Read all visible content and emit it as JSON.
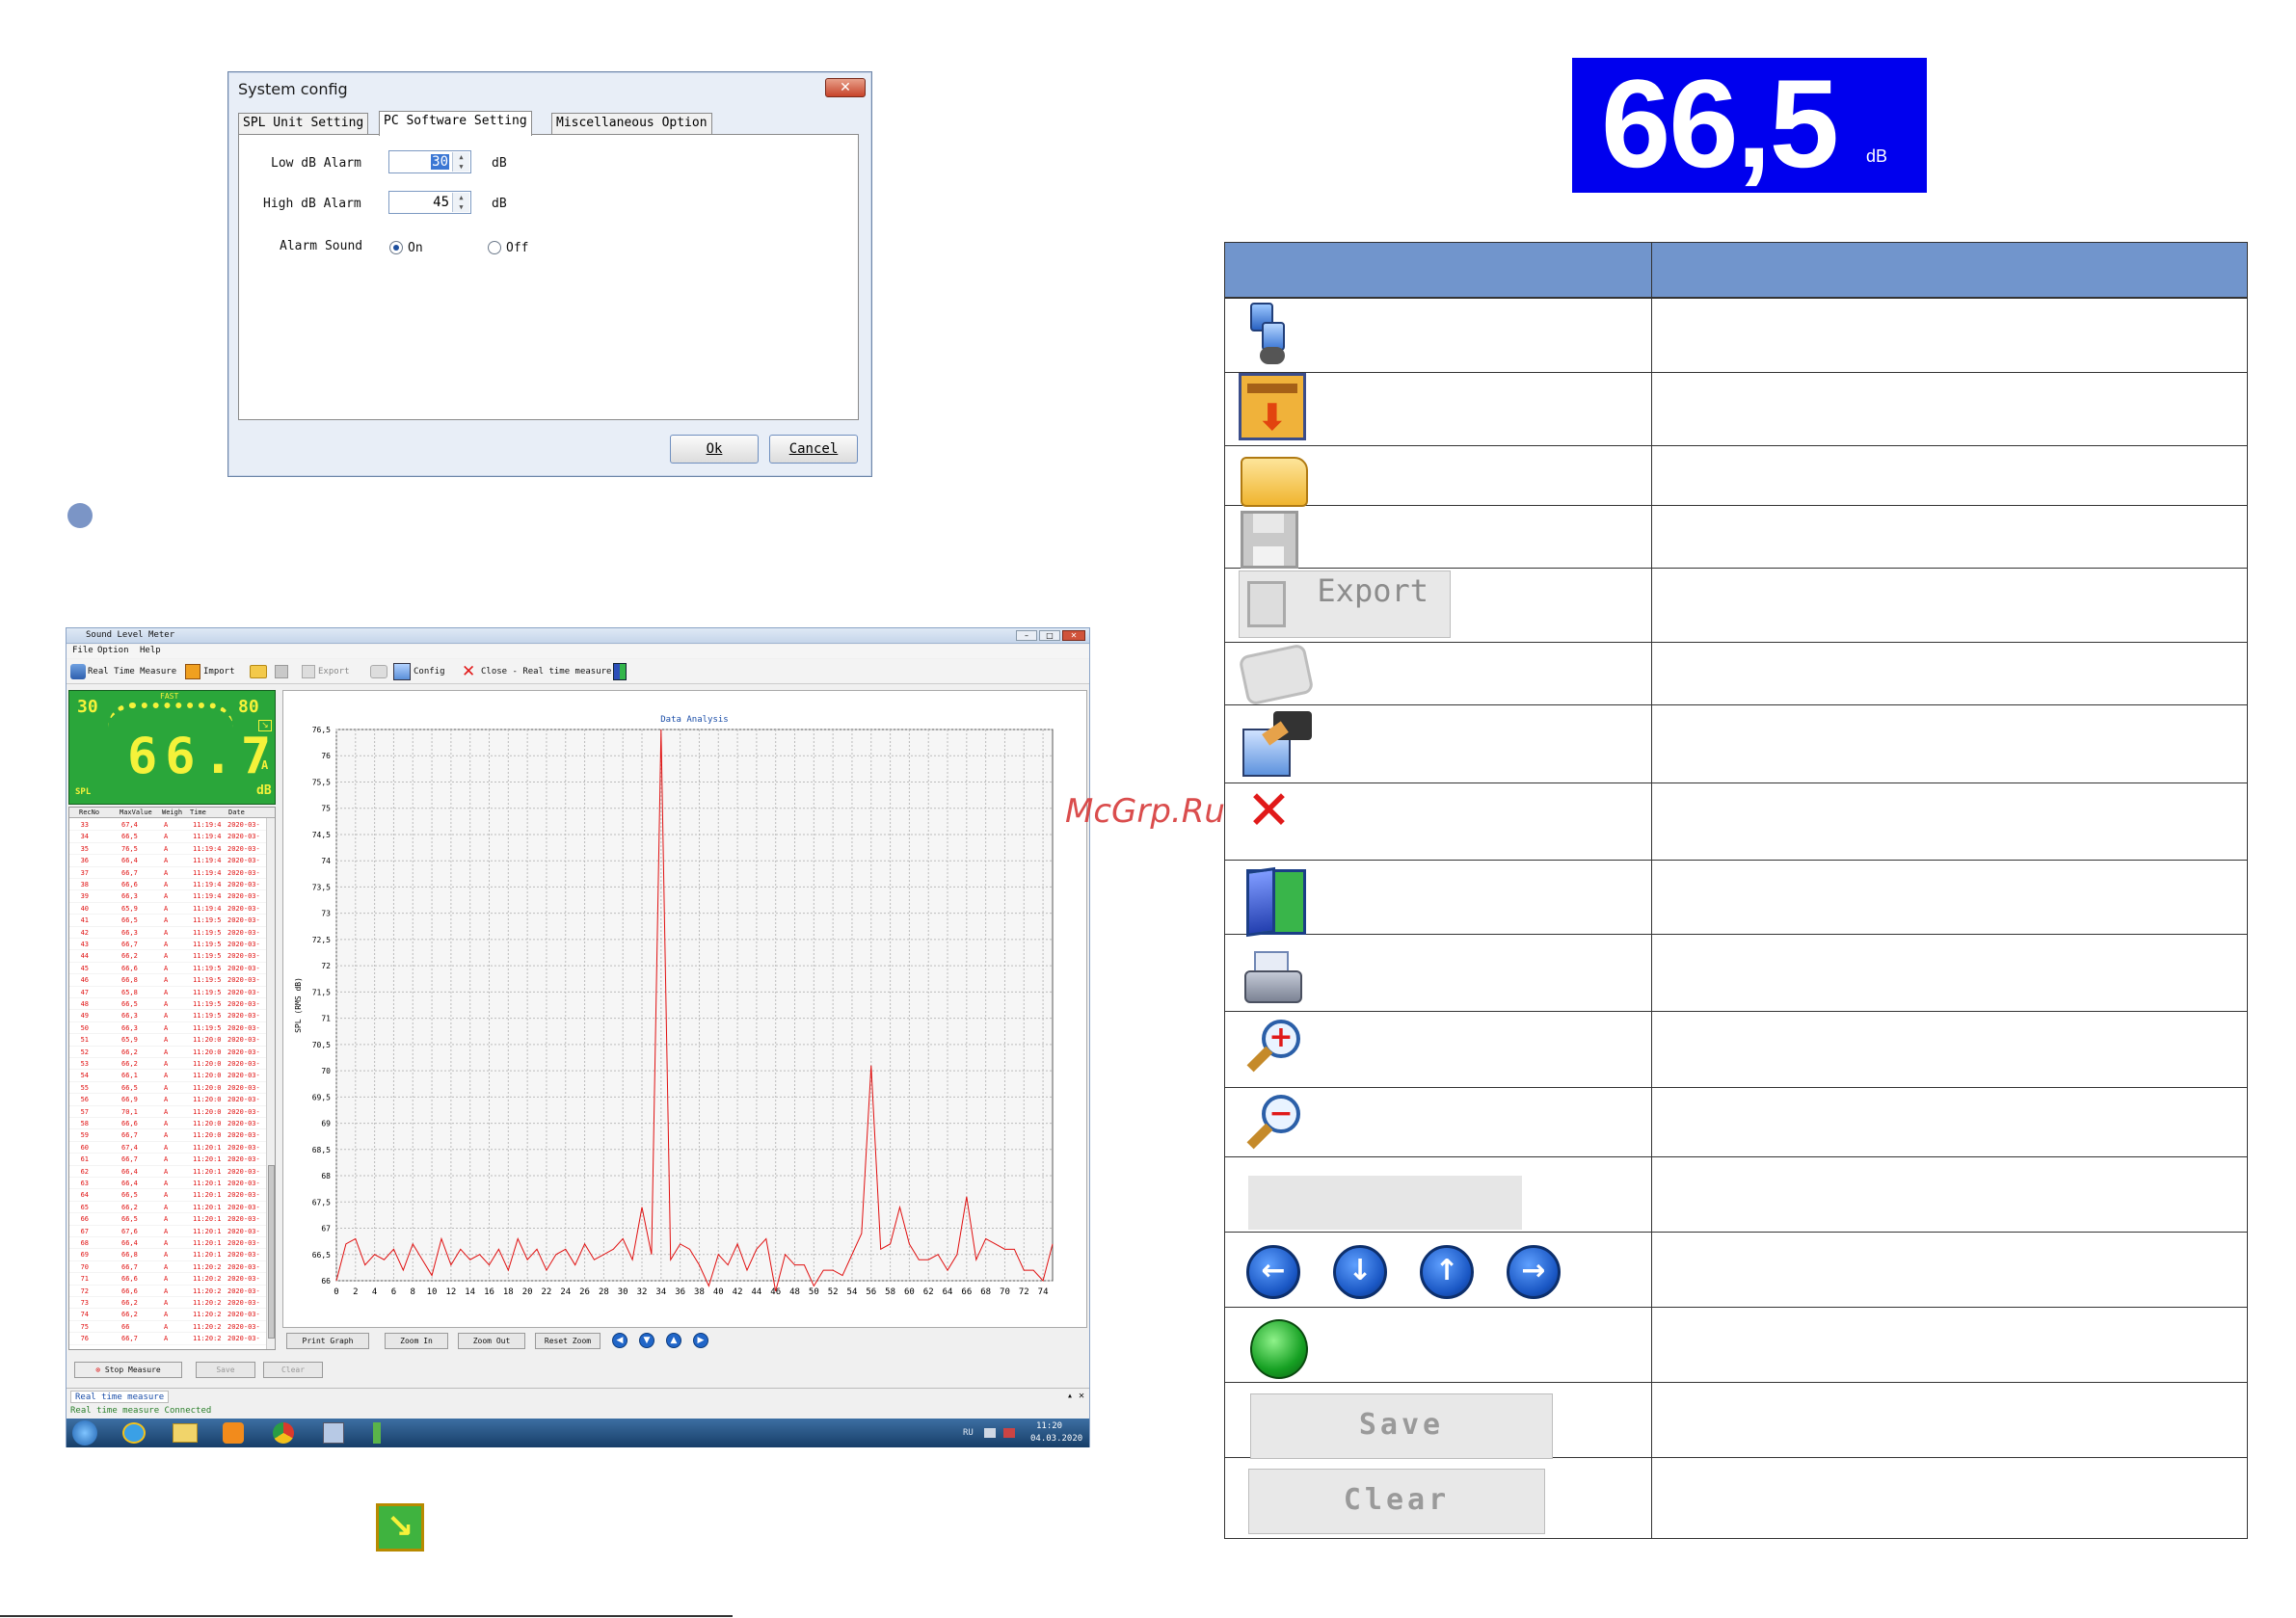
{
  "system_config": {
    "title": "System config",
    "close": "✕",
    "tabs": [
      "SPL Unit Setting",
      "PC Software Setting",
      "Miscellaneous Option"
    ],
    "low_label": "Low dB Alarm",
    "low_value": "30",
    "high_label": "High dB Alarm",
    "high_value": "45",
    "unit": "dB",
    "alarm_label": "Alarm Sound",
    "on_label": "On",
    "off_label": "Off",
    "ok": "Ok",
    "cancel": "Cancel"
  },
  "app": {
    "title": "Sound Level Meter",
    "menu": [
      "File",
      "Option",
      "Help"
    ],
    "toolbar": {
      "realtime": "Real Time Measure",
      "import": "Import",
      "export": "Export",
      "config": "Config",
      "close": "Close - Real time measure"
    },
    "meter": {
      "low": "30",
      "high": "80",
      "mode": "FAST",
      "value": "66.7",
      "weight": "A",
      "unit": "dB",
      "label": "SPL"
    },
    "grid": {
      "headers": [
        "RecNo",
        "MaxValue",
        "Weigh",
        "Time",
        "Date"
      ],
      "rows": [
        [
          "33",
          "67,4",
          "A",
          "11:19:4",
          "2020-03-"
        ],
        [
          "34",
          "66,5",
          "A",
          "11:19:4",
          "2020-03-"
        ],
        [
          "35",
          "76,5",
          "A",
          "11:19:4",
          "2020-03-"
        ],
        [
          "36",
          "66,4",
          "A",
          "11:19:4",
          "2020-03-"
        ],
        [
          "37",
          "66,7",
          "A",
          "11:19:4",
          "2020-03-"
        ],
        [
          "38",
          "66,6",
          "A",
          "11:19:4",
          "2020-03-"
        ],
        [
          "39",
          "66,3",
          "A",
          "11:19:4",
          "2020-03-"
        ],
        [
          "40",
          "65,9",
          "A",
          "11:19:4",
          "2020-03-"
        ],
        [
          "41",
          "66,5",
          "A",
          "11:19:5",
          "2020-03-"
        ],
        [
          "42",
          "66,3",
          "A",
          "11:19:5",
          "2020-03-"
        ],
        [
          "43",
          "66,7",
          "A",
          "11:19:5",
          "2020-03-"
        ],
        [
          "44",
          "66,2",
          "A",
          "11:19:5",
          "2020-03-"
        ],
        [
          "45",
          "66,6",
          "A",
          "11:19:5",
          "2020-03-"
        ],
        [
          "46",
          "66,8",
          "A",
          "11:19:5",
          "2020-03-"
        ],
        [
          "47",
          "65,8",
          "A",
          "11:19:5",
          "2020-03-"
        ],
        [
          "48",
          "66,5",
          "A",
          "11:19:5",
          "2020-03-"
        ],
        [
          "49",
          "66,3",
          "A",
          "11:19:5",
          "2020-03-"
        ],
        [
          "50",
          "66,3",
          "A",
          "11:19:5",
          "2020-03-"
        ],
        [
          "51",
          "65,9",
          "A",
          "11:20:0",
          "2020-03-"
        ],
        [
          "52",
          "66,2",
          "A",
          "11:20:0",
          "2020-03-"
        ],
        [
          "53",
          "66,2",
          "A",
          "11:20:0",
          "2020-03-"
        ],
        [
          "54",
          "66,1",
          "A",
          "11:20:0",
          "2020-03-"
        ],
        [
          "55",
          "66,5",
          "A",
          "11:20:0",
          "2020-03-"
        ],
        [
          "56",
          "66,9",
          "A",
          "11:20:0",
          "2020-03-"
        ],
        [
          "57",
          "70,1",
          "A",
          "11:20:0",
          "2020-03-"
        ],
        [
          "58",
          "66,6",
          "A",
          "11:20:0",
          "2020-03-"
        ],
        [
          "59",
          "66,7",
          "A",
          "11:20:0",
          "2020-03-"
        ],
        [
          "60",
          "67,4",
          "A",
          "11:20:1",
          "2020-03-"
        ],
        [
          "61",
          "66,7",
          "A",
          "11:20:1",
          "2020-03-"
        ],
        [
          "62",
          "66,4",
          "A",
          "11:20:1",
          "2020-03-"
        ],
        [
          "63",
          "66,4",
          "A",
          "11:20:1",
          "2020-03-"
        ],
        [
          "64",
          "66,5",
          "A",
          "11:20:1",
          "2020-03-"
        ],
        [
          "65",
          "66,2",
          "A",
          "11:20:1",
          "2020-03-"
        ],
        [
          "66",
          "66,5",
          "A",
          "11:20:1",
          "2020-03-"
        ],
        [
          "67",
          "67,6",
          "A",
          "11:20:1",
          "2020-03-"
        ],
        [
          "68",
          "66,4",
          "A",
          "11:20:1",
          "2020-03-"
        ],
        [
          "69",
          "66,8",
          "A",
          "11:20:1",
          "2020-03-"
        ],
        [
          "70",
          "66,7",
          "A",
          "11:20:2",
          "2020-03-"
        ],
        [
          "71",
          "66,6",
          "A",
          "11:20:2",
          "2020-03-"
        ],
        [
          "72",
          "66,6",
          "A",
          "11:20:2",
          "2020-03-"
        ],
        [
          "73",
          "66,2",
          "A",
          "11:20:2",
          "2020-03-"
        ],
        [
          "74",
          "66,2",
          "A",
          "11:20:2",
          "2020-03-"
        ],
        [
          "75",
          "66",
          "A",
          "11:20:2",
          "2020-03-"
        ],
        [
          "76",
          "66,7",
          "A",
          "11:20:2",
          "2020-03-"
        ]
      ]
    },
    "graph": {
      "buttons": [
        "Print Graph",
        "Zoom In",
        "Zoom Out",
        "Reset Zoom"
      ]
    },
    "bottom": {
      "stop": "Stop Measure",
      "save": "Save",
      "clear": "Clear",
      "tab": "Real time measure",
      "status": "Real time measure Connected"
    },
    "tray": {
      "lang": "RU",
      "time": "11:20",
      "date": "04.03.2020"
    }
  },
  "chart_data": {
    "type": "line",
    "title": "Data Analysis",
    "ylabel": "SPL (RMS dB)",
    "xlim": [
      0,
      75
    ],
    "ylim": [
      66,
      76.5
    ],
    "xticks": [
      0,
      2,
      4,
      6,
      8,
      10,
      12,
      14,
      16,
      18,
      20,
      22,
      24,
      26,
      28,
      30,
      32,
      34,
      36,
      38,
      40,
      42,
      44,
      46,
      48,
      50,
      52,
      54,
      56,
      58,
      60,
      62,
      64,
      66,
      68,
      70,
      72,
      74
    ],
    "yticks": [
      66,
      66.5,
      67,
      67.5,
      68,
      68.5,
      69,
      69.5,
      70,
      70.5,
      71,
      71.5,
      72,
      72.5,
      73,
      73.5,
      74,
      74.5,
      75,
      75.5,
      76,
      76.5
    ],
    "ytick_labels": [
      "66",
      "66,5",
      "67",
      "67,5",
      "68",
      "68,5",
      "69",
      "69,5",
      "70",
      "70,5",
      "71",
      "71,5",
      "72",
      "72,5",
      "73",
      "73,5",
      "74",
      "74,5",
      "75",
      "75,5",
      "76",
      "76,5"
    ],
    "grid": true,
    "series": [
      {
        "color": "#e01010",
        "x": [
          0,
          1,
          2,
          3,
          4,
          5,
          6,
          7,
          8,
          9,
          10,
          11,
          12,
          13,
          14,
          15,
          16,
          17,
          18,
          19,
          20,
          21,
          22,
          23,
          24,
          25,
          26,
          27,
          28,
          29,
          30,
          31,
          32,
          33,
          34,
          35,
          36,
          37,
          38,
          39,
          40,
          41,
          42,
          43,
          44,
          45,
          46,
          47,
          48,
          49,
          50,
          51,
          52,
          53,
          54,
          55,
          56,
          57,
          58,
          59,
          60,
          61,
          62,
          63,
          64,
          65,
          66,
          67,
          68,
          69,
          70,
          71,
          72,
          73,
          74,
          75
        ],
        "y": [
          66,
          66.7,
          66.8,
          66.3,
          66.5,
          66.4,
          66.6,
          66.2,
          66.7,
          66.4,
          66.1,
          66.8,
          66.3,
          66.6,
          66.4,
          66.5,
          66.3,
          66.6,
          66.2,
          66.8,
          66.4,
          66.6,
          66.2,
          66.5,
          66.6,
          66.3,
          66.7,
          66.4,
          66.5,
          66.6,
          66.8,
          66.4,
          67.4,
          66.5,
          76.5,
          66.4,
          66.7,
          66.6,
          66.3,
          65.9,
          66.5,
          66.3,
          66.7,
          66.2,
          66.6,
          66.8,
          65.8,
          66.5,
          66.3,
          66.3,
          65.9,
          66.2,
          66.2,
          66.1,
          66.5,
          66.9,
          70.1,
          66.6,
          66.7,
          67.4,
          66.7,
          66.4,
          66.4,
          66.5,
          66.2,
          66.5,
          67.6,
          66.4,
          66.8,
          66.7,
          66.6,
          66.6,
          66.2,
          66.2,
          66,
          66.7
        ]
      }
    ]
  },
  "right": {
    "big_value": "66,5",
    "big_unit": "dB",
    "save": "Save",
    "clear": "Clear",
    "export": "Export"
  },
  "watermark": "McGrp.Ru"
}
